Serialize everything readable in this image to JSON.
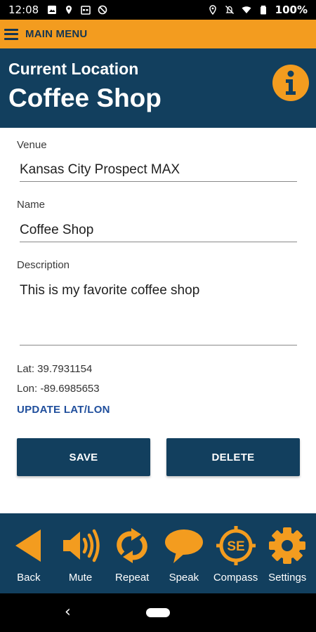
{
  "status_bar": {
    "time": "12:08",
    "battery": "100%",
    "left_icons": [
      "image-icon",
      "location-icon",
      "calendar-icon",
      "block-icon"
    ],
    "right_icons": [
      "location-icon",
      "mute-icon",
      "wifi-icon",
      "battery-icon"
    ]
  },
  "menu_bar": {
    "label": "MAIN MENU"
  },
  "header": {
    "subtitle": "Current Location",
    "title": "Coffee Shop"
  },
  "form": {
    "venue_label": "Venue",
    "venue_value": "Kansas City Prospect MAX",
    "name_label": "Name",
    "name_value": "Coffee Shop",
    "description_label": "Description",
    "description_value": "This is my favorite coffee shop",
    "lat": "Lat: 39.7931154",
    "lon": "Lon: -89.6985653",
    "update_link": "UPDATE LAT/LON"
  },
  "buttons": {
    "save": "SAVE",
    "delete": "DELETE"
  },
  "bottom_nav": [
    {
      "label": "Back",
      "icon": "back-arrow-icon"
    },
    {
      "label": "Mute",
      "icon": "speaker-icon"
    },
    {
      "label": "Repeat",
      "icon": "repeat-icon"
    },
    {
      "label": "Speak",
      "icon": "speech-bubble-icon"
    },
    {
      "label": "Compass",
      "icon": "compass-icon",
      "badge": "SE"
    },
    {
      "label": "Settings",
      "icon": "gear-icon"
    }
  ],
  "colors": {
    "accent": "#f39c1f",
    "primary": "#123f5e",
    "link": "#1f4e9c"
  }
}
